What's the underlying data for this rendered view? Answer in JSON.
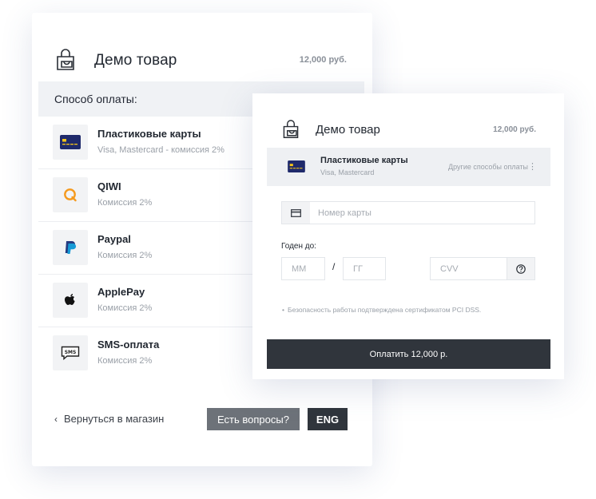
{
  "product": {
    "title": "Демо товар",
    "price": "12,000 руб."
  },
  "methods_panel": {
    "heading": "Способ оплаты:",
    "items": [
      {
        "name": "Пластиковые карты",
        "sub": "Visa, Mastercard - комиссия 2%",
        "icon": "credit-card-icon"
      },
      {
        "name": "QIWI",
        "sub": "Комиссия 2%",
        "icon": "qiwi-icon"
      },
      {
        "name": "Paypal",
        "sub": "Комиссия 2%",
        "icon": "paypal-icon"
      },
      {
        "name": "ApplePay",
        "sub": "Комиссия 2%",
        "icon": "apple-icon"
      },
      {
        "name": "SMS-оплата",
        "sub": "Комиссия 2%",
        "icon": "sms-icon"
      }
    ]
  },
  "footer": {
    "back_link": "Вернуться в магазин",
    "questions_button": "Есть вопросы?",
    "lang_button": "ENG"
  },
  "payment_form": {
    "title": "Демо товар",
    "price": "12,000 руб.",
    "selected_method": {
      "name": "Пластиковые карты",
      "sub": "Visa, Mastercard"
    },
    "other_methods": "Другие способы оплаты",
    "card_number_placeholder": "Номер карты",
    "valid_label": "Годен до:",
    "month_placeholder": "ММ",
    "year_placeholder": "ГГ",
    "slash": "/",
    "cvv_placeholder": "CVV",
    "pci_note": "Безопасность работы подтверждена сертификатом PCI DSS.",
    "pay_button": "Оплатить 12,000 р."
  },
  "colors": {
    "dark_button": "#30353c",
    "grey_button": "#6d7279",
    "panel_grey": "#f0f2f5",
    "card_blue": "#1f2a6b",
    "card_chip": "#f5c518",
    "qiwi_orange": "#f59a1e"
  }
}
